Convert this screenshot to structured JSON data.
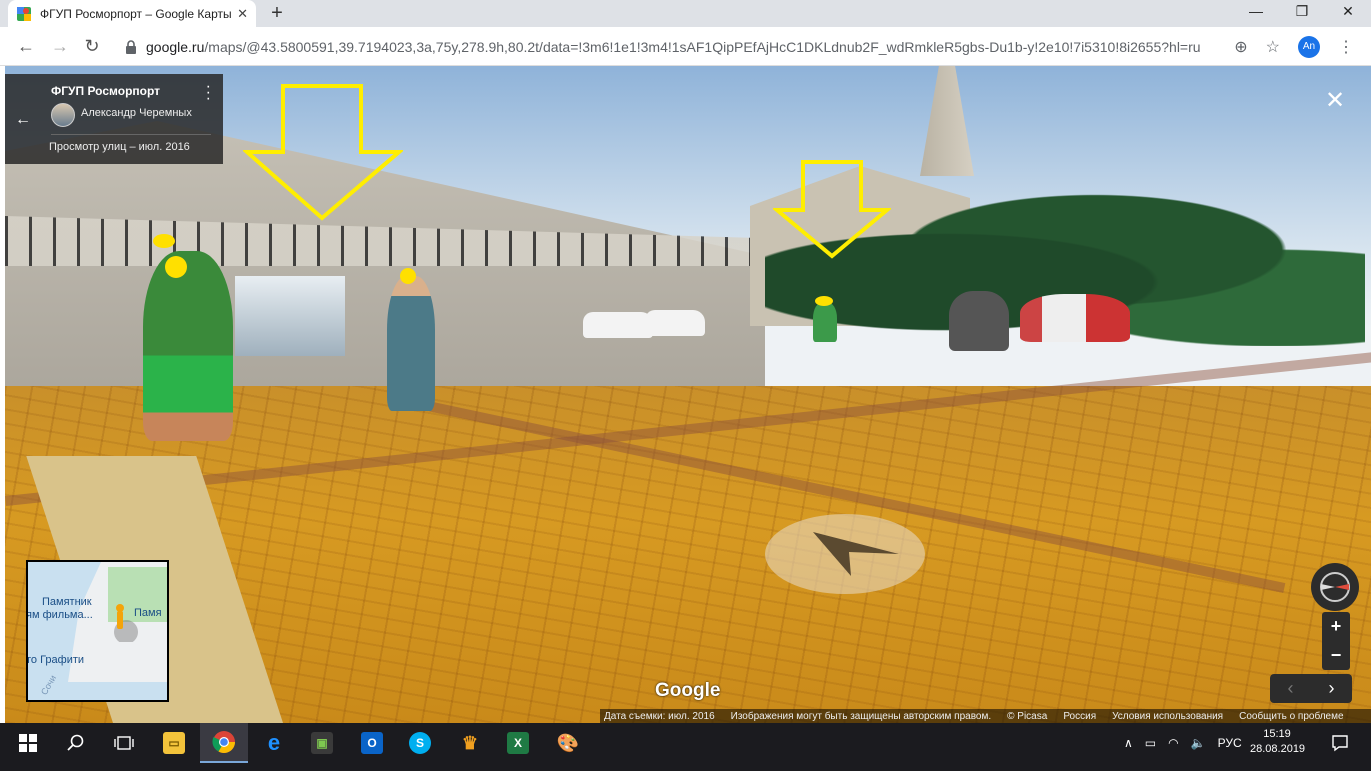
{
  "browser": {
    "tab_title": "ФГУП Росморпорт – Google Карты",
    "tab_close": "✕",
    "new_tab": "+",
    "url_host": "google.ru",
    "url_path": "/maps/@43.5800591,39.7194023,3a,75y,278.9h,80.2t/data=!3m6!1e1!3m4!1sAF1QipPEfAjHcC1DKLdnub2F_wdRmkleR5gbs-Du1b-y!2e10!7i5310!8i2655?hl=ru",
    "avatar_initials": "An"
  },
  "streetview": {
    "place_name": "ФГУП Росморпорт",
    "author": "Александр Черемных",
    "capture_label": "Просмотр улиц – июл. 2016",
    "google_logo": "Google",
    "minimap": {
      "label_1": "Памятник",
      "label_2": "ям фильма...",
      "label_3": "Памя",
      "label_4": "то Графити",
      "label_5": "Сочи"
    },
    "footer": [
      "Дата съемки: июл. 2016",
      "Изображения могут быть защищены авторским правом.",
      "© Picasa",
      "Россия",
      "Условия использования",
      "Сообщить о проблеме"
    ]
  },
  "taskbar": {
    "language": "РУС",
    "time": "15:19",
    "date": "28.08.2019"
  },
  "colors": {
    "annotation_arrow": "#ffee00",
    "pavement": "#d79a22",
    "taskbar": "#1b1b1f",
    "chrome_tabstrip": "#dee1e6"
  },
  "icons": [
    "maps-favicon",
    "back-icon",
    "forward-icon",
    "reload-icon",
    "lock-icon",
    "add-icon",
    "star-icon",
    "kebab-menu-icon",
    "close-icon",
    "compass-icon",
    "zoom-in-icon",
    "zoom-out-icon",
    "windows-start-icon",
    "search-icon",
    "task-view-icon",
    "explorer-icon",
    "chrome-icon",
    "edge-icon",
    "outlook-icon",
    "skype-icon",
    "excel-icon",
    "paint-icon",
    "notification-icon"
  ]
}
